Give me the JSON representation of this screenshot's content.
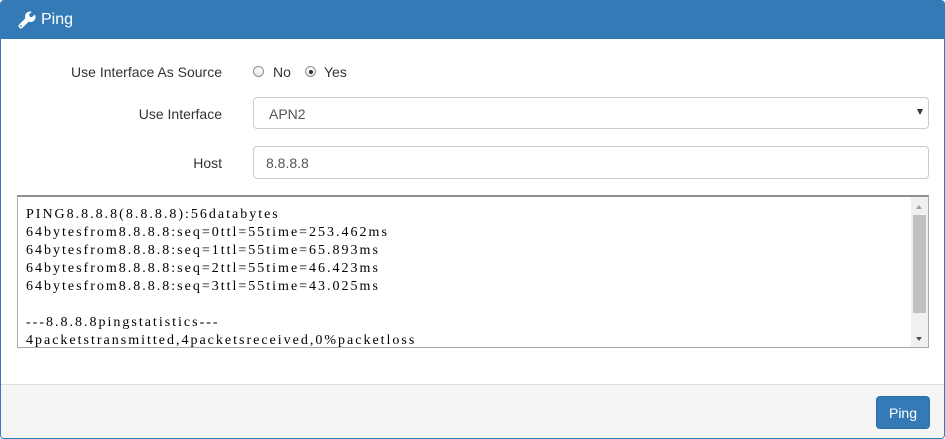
{
  "header": {
    "icon": "wrench-icon",
    "title": "Ping"
  },
  "form": {
    "source": {
      "label": "Use Interface As Source",
      "options": [
        "No",
        "Yes"
      ],
      "selected": "Yes"
    },
    "interface": {
      "label": "Use Interface",
      "value": "APN2"
    },
    "host": {
      "label": "Host",
      "value": "8.8.8.8"
    }
  },
  "output": {
    "lines": [
      "PING8.8.8.8(8.8.8.8):56databytes",
      "64bytesfrom8.8.8.8:seq=0ttl=55time=253.462ms",
      "64bytesfrom8.8.8.8:seq=1ttl=55time=65.893ms",
      "64bytesfrom8.8.8.8:seq=2ttl=55time=46.423ms",
      "64bytesfrom8.8.8.8:seq=3ttl=55time=43.025ms",
      "",
      "---8.8.8.8pingstatistics---",
      "4packetstransmitted,4packetsreceived,0%packetloss"
    ]
  },
  "footer": {
    "button_label": "Ping"
  },
  "colors": {
    "primary": "#337ab7",
    "footer_bg": "#f5f5f5"
  }
}
